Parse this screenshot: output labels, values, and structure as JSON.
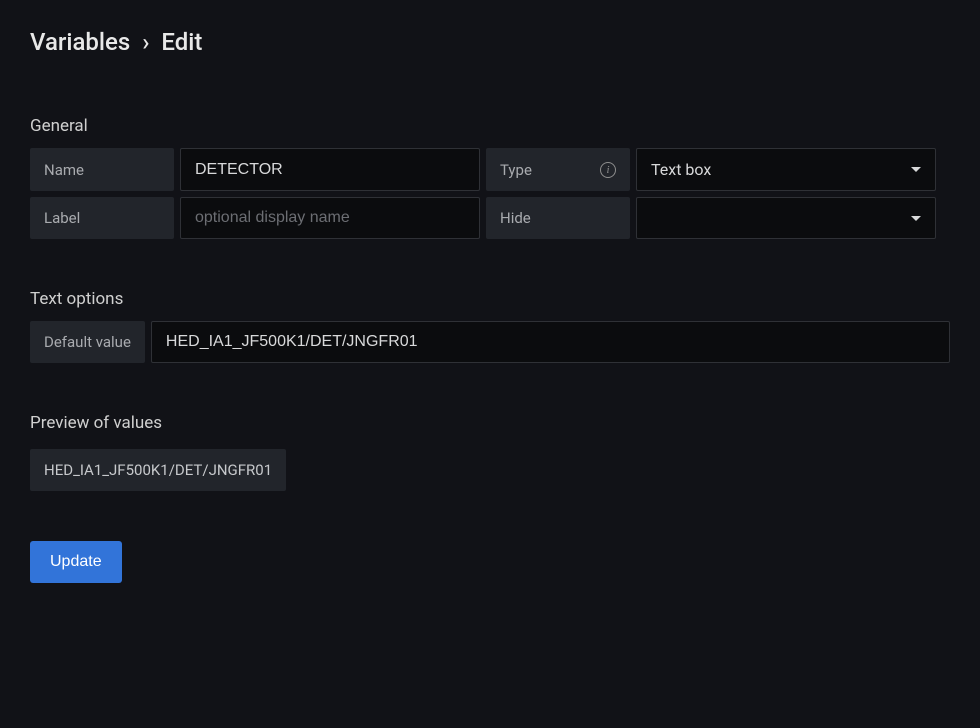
{
  "breadcrumb": {
    "parent": "Variables",
    "separator": "›",
    "current": "Edit"
  },
  "sections": {
    "general": {
      "title": "General",
      "fields": {
        "name": {
          "label": "Name",
          "value": "DETECTOR"
        },
        "type": {
          "label": "Type",
          "value": "Text box"
        },
        "labelField": {
          "label": "Label",
          "placeholder": "optional display name",
          "value": ""
        },
        "hide": {
          "label": "Hide",
          "value": ""
        }
      }
    },
    "textOptions": {
      "title": "Text options",
      "defaultValue": {
        "label": "Default value",
        "value": "HED_IA1_JF500K1/DET/JNGFR01"
      }
    },
    "preview": {
      "title": "Preview of values",
      "values": [
        "HED_IA1_JF500K1/DET/JNGFR01"
      ]
    }
  },
  "buttons": {
    "update": "Update"
  }
}
